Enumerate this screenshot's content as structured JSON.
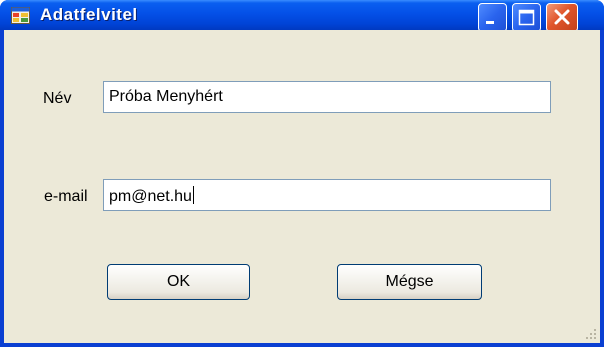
{
  "window": {
    "title": "Adatfelvitel",
    "controls": {
      "minimize": "minimize-icon",
      "maximize": "maximize-icon",
      "close": "close-icon"
    }
  },
  "form": {
    "name_label": "Név",
    "name_value": "Próba Menyhért",
    "email_label": "e-mail",
    "email_value": "pm@net.hu",
    "ok_label": "OK",
    "cancel_label": "Mégse"
  },
  "colors": {
    "titlebar": "#0450e7",
    "client": "#ece9d8",
    "close_button": "#e0552b",
    "textbox_border": "#7f9db9"
  }
}
